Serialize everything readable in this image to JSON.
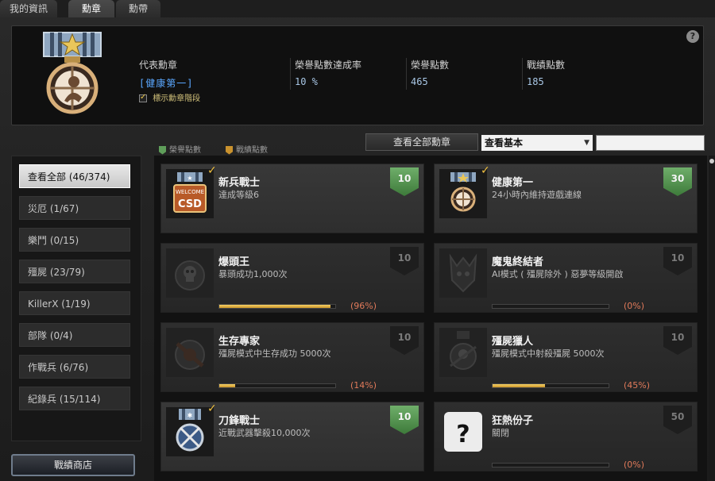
{
  "tabs": [
    {
      "label": "我的資訊"
    },
    {
      "label": "勳章"
    },
    {
      "label": "勳帶"
    }
  ],
  "header": {
    "help": "?",
    "representative": {
      "label": "代表勳章",
      "value": "[健康第一]"
    },
    "show_grade_label": "標示勳章階段",
    "rate": {
      "label": "榮譽點數達成率",
      "value": "10 %"
    },
    "honor": {
      "label": "榮譽點數",
      "value": "465"
    },
    "merit": {
      "label": "戰績點數",
      "value": "185"
    }
  },
  "legend": {
    "honor": "榮譽點數",
    "merit": "戰績點數"
  },
  "filter": {
    "view_all": "查看全部勳章",
    "select_value": "查看基本",
    "search_value": ""
  },
  "categories": [
    {
      "label": "查看全部 (46/374)"
    },
    {
      "label": "災厄 (1/67)"
    },
    {
      "label": "樂鬥 (0/15)"
    },
    {
      "label": "殭屍 (23/79)"
    },
    {
      "label": "KillerX (1/19)"
    },
    {
      "label": "部隊 (0/4)"
    },
    {
      "label": "作戰兵 (6/76)"
    },
    {
      "label": "紀錄兵 (15/114)"
    }
  ],
  "shop_button": "戰績商店",
  "medals": [
    {
      "title": "新兵戰士",
      "desc": "達成等級6",
      "points": "10",
      "earned": true,
      "progress": null,
      "pct": ""
    },
    {
      "title": "健康第一",
      "desc": "24小時內維持遊戲連線",
      "points": "30",
      "earned": true,
      "progress": null,
      "pct": ""
    },
    {
      "title": "爆頭王",
      "desc": "暴頭成功1,000次",
      "points": "10",
      "earned": false,
      "progress": 0.96,
      "pct": "(96%)"
    },
    {
      "title": "魔鬼終結者",
      "desc": "AI模式 ( 殭屍除外 ) 惡夢等級開啟",
      "points": "10",
      "earned": false,
      "progress": 0,
      "pct": "(0%)"
    },
    {
      "title": "生存專家",
      "desc": "殭屍模式中生存成功 5000次",
      "points": "10",
      "earned": false,
      "progress": 0.14,
      "pct": "(14%)"
    },
    {
      "title": "殭屍獵人",
      "desc": "殭屍模式中射殺殭屍 5000次",
      "points": "10",
      "earned": false,
      "progress": 0.45,
      "pct": "(45%)"
    },
    {
      "title": "刀鋒戰士",
      "desc": "近戰武器擊殺10,000次",
      "points": "10",
      "earned": true,
      "progress": null,
      "pct": ""
    },
    {
      "title": "狂熱份子",
      "desc": "關閉",
      "points": "50",
      "earned": false,
      "progress": 0,
      "pct": "(0%)"
    }
  ],
  "icon_text": {
    "welcome": "WELCOME",
    "csd": "CSD",
    "question": "?"
  },
  "colors": {
    "accent_gold": "#f0c040",
    "honor_green": "#5f9e5a",
    "representative_blue": "#5aa7ff",
    "progress_pct": "#e07a5a"
  }
}
